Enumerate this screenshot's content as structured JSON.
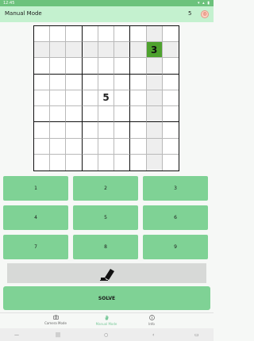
{
  "status": {
    "time": "12:45",
    "right": "▾ ▴ ▮"
  },
  "appbar": {
    "title": "Manual Mode",
    "count": "5",
    "avatar_letter": "◎"
  },
  "grid": {
    "rows": 9,
    "cols": 9,
    "highlight_col": 7,
    "highlight_row": 1,
    "selected": {
      "row": 1,
      "col": 7
    },
    "values": [
      [
        "",
        "",
        "",
        "",
        "",
        "",
        "",
        "",
        ""
      ],
      [
        "",
        "",
        "",
        "",
        "",
        "",
        "",
        "3",
        ""
      ],
      [
        "",
        "",
        "",
        "",
        "",
        "",
        "",
        "",
        ""
      ],
      [
        "",
        "",
        "",
        "",
        "",
        "",
        "",
        "",
        ""
      ],
      [
        "",
        "",
        "",
        "",
        "5",
        "",
        "",
        "",
        ""
      ],
      [
        "",
        "",
        "",
        "",
        "",
        "",
        "",
        "",
        ""
      ],
      [
        "",
        "",
        "",
        "",
        "",
        "",
        "",
        "",
        ""
      ],
      [
        "",
        "",
        "",
        "",
        "",
        "",
        "",
        "",
        ""
      ],
      [
        "",
        "",
        "",
        "",
        "",
        "",
        "",
        "",
        ""
      ]
    ]
  },
  "keypad": [
    "1",
    "2",
    "3",
    "4",
    "5",
    "6",
    "7",
    "8",
    "9"
  ],
  "solve_label": "SOLVE",
  "nav": [
    {
      "label": "Camera Mode",
      "icon": "camera-icon",
      "active": false
    },
    {
      "label": "Manual Mode",
      "icon": "hand-icon",
      "active": true
    },
    {
      "label": "Info",
      "icon": "info-icon",
      "active": false
    }
  ],
  "colors": {
    "accent": "#7fd295",
    "selected": "#4ea22e",
    "appbar": "#c4f1cf"
  }
}
